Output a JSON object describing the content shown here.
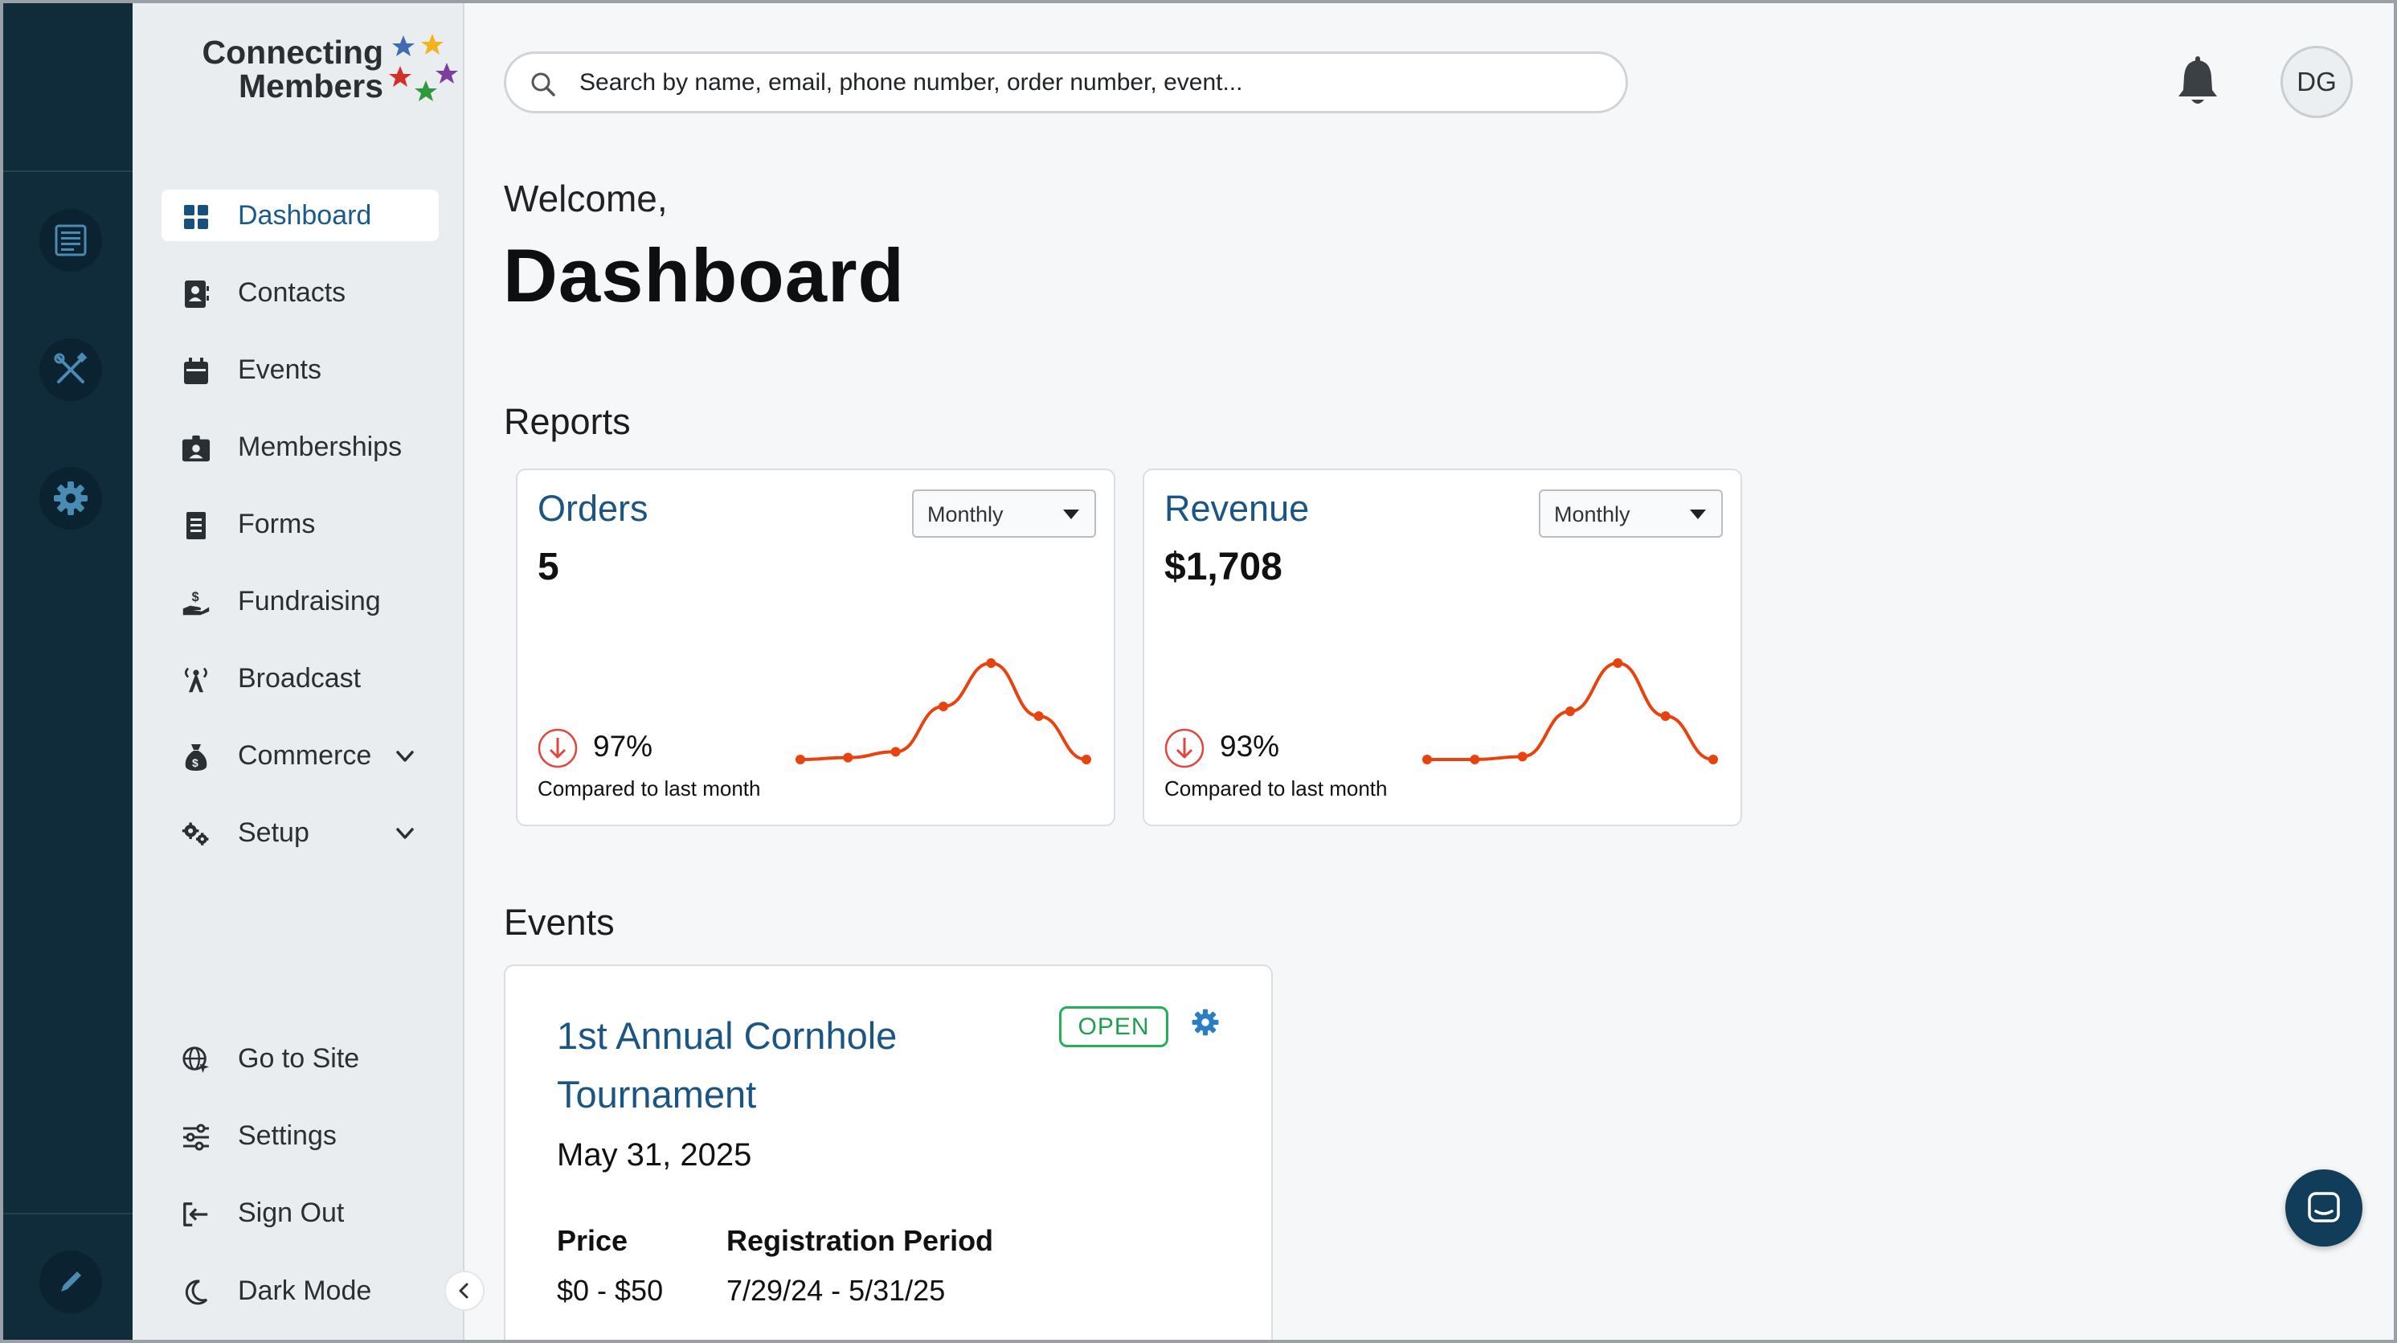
{
  "brand": {
    "name_line1": "Connecting",
    "name_line2": "Members"
  },
  "rail": {
    "items": [
      {
        "icon": "document-list-icon"
      },
      {
        "icon": "tools-icon"
      },
      {
        "icon": "gear-icon"
      },
      {
        "icon": "pencil-icon"
      }
    ]
  },
  "sidebar": {
    "items": [
      {
        "label": "Dashboard",
        "icon": "grid-icon",
        "active": true
      },
      {
        "label": "Contacts",
        "icon": "contact-card-icon"
      },
      {
        "label": "Events",
        "icon": "calendar-icon"
      },
      {
        "label": "Memberships",
        "icon": "id-badge-icon"
      },
      {
        "label": "Forms",
        "icon": "form-icon"
      },
      {
        "label": "Fundraising",
        "icon": "donation-hand-icon"
      },
      {
        "label": "Broadcast",
        "icon": "broadcast-tower-icon"
      },
      {
        "label": "Commerce",
        "icon": "money-bag-icon",
        "expandable": true
      },
      {
        "label": "Setup",
        "icon": "gears-icon",
        "expandable": true
      }
    ],
    "bottom": [
      {
        "label": "Go to Site",
        "icon": "globe-icon"
      },
      {
        "label": "Settings",
        "icon": "sliders-icon"
      },
      {
        "label": "Sign Out",
        "icon": "sign-out-icon"
      },
      {
        "label": "Dark Mode",
        "icon": "moon-icon"
      }
    ]
  },
  "header": {
    "search_placeholder": "Search by name, email, phone number, order number, event...",
    "avatar_initials": "DG"
  },
  "main": {
    "welcome": "Welcome,",
    "title": "Dashboard",
    "reports_heading": "Reports",
    "events_heading": "Events"
  },
  "reports": [
    {
      "title": "Orders",
      "value": "5",
      "period": "Monthly",
      "change": "97%",
      "compare": "Compared to last month",
      "trend": "down",
      "sparkline": [
        0.0,
        0.02,
        0.08,
        0.55,
        1.0,
        0.45,
        0.0
      ]
    },
    {
      "title": "Revenue",
      "value": "$1,708",
      "period": "Monthly",
      "change": "93%",
      "compare": "Compared to last month",
      "trend": "down",
      "sparkline": [
        0.0,
        0.0,
        0.03,
        0.5,
        1.0,
        0.45,
        0.0
      ]
    }
  ],
  "events": [
    {
      "title": "1st Annual Cornhole Tournament",
      "status": "OPEN",
      "date": "May 31, 2025",
      "price_label": "Price",
      "price": "$0 - $50",
      "reg_label": "Registration Period",
      "reg_period": "7/29/24 - 5/31/25"
    }
  ],
  "colors": {
    "rail_bg": "#102c3b",
    "sidebar_bg": "#e9edf0",
    "accent_blue": "#1b5585",
    "spark_orange": "#e8430f",
    "open_green": "#22b05a",
    "down_red": "#e0473f"
  }
}
